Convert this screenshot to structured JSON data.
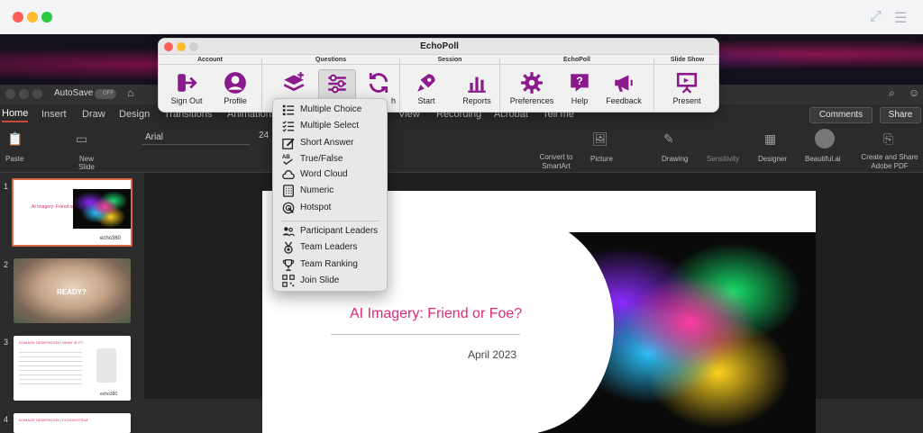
{
  "echopoll": {
    "title": "EchoPoll",
    "groups": {
      "account": "Account",
      "questions": "Questions",
      "session": "Session",
      "echopoll": "EchoPoll",
      "slideshow": "Slide Show"
    },
    "buttons": {
      "sign_out": "Sign Out",
      "profile": "Profile",
      "refresh_tail": "h",
      "start": "Start",
      "reports": "Reports",
      "preferences": "Preferences",
      "help": "Help",
      "feedback": "Feedback",
      "present": "Present"
    },
    "accent_color": "#8b1a8c"
  },
  "question_menu": {
    "items": [
      {
        "label": "Multiple Choice",
        "icon": "list-bullets-icon"
      },
      {
        "label": "Multiple Select",
        "icon": "checklist-icon"
      },
      {
        "label": "Short Answer",
        "icon": "edit-box-icon"
      },
      {
        "label": "True/False",
        "icon": "ab-check-icon"
      },
      {
        "label": "Word Cloud",
        "icon": "cloud-icon"
      },
      {
        "label": "Numeric",
        "icon": "keypad-icon"
      },
      {
        "label": "Hotspot",
        "icon": "target-pointer-icon"
      }
    ],
    "leader_items": [
      {
        "label": "Participant Leaders",
        "icon": "people-icon"
      },
      {
        "label": "Team Leaders",
        "icon": "medal-icon"
      },
      {
        "label": "Team Ranking",
        "icon": "trophy-icon"
      },
      {
        "label": "Join Slide",
        "icon": "qr-code-icon"
      }
    ]
  },
  "ppt": {
    "autosave": "AutoSave",
    "autosave_state": "OFF",
    "tabs": [
      "Home",
      "Insert",
      "Draw",
      "Design",
      "Transitions",
      "Animations",
      "View",
      "Recording",
      "Acrobat",
      "Tell me"
    ],
    "comments": "Comments",
    "share": "Share",
    "font_name": "Arial",
    "font_size": "24",
    "ribbon": {
      "paste": "Paste",
      "new_slide": "New\nSlide",
      "convert_to_smartart": "Convert to\nSmartArt",
      "picture": "Picture",
      "drawing": "Drawing",
      "sensitivity": "Sensitivity",
      "designer": "Designer",
      "beautiful_ai": "Beautiful.ai",
      "create_share_pdf": "Create and Share\nAdobe PDF"
    },
    "thumbnails": [
      {
        "num": "1",
        "title": "AI Imagery: Friend or Foe?",
        "brand": "echo360"
      },
      {
        "num": "2",
        "caption": "READY?"
      },
      {
        "num": "3",
        "heading": "AI IMAGE GENERATION | WHAT IS IT?",
        "brand": "echo360"
      },
      {
        "num": "4",
        "heading": "AI IMAGE GENERATION | ECHOSYSTEM"
      }
    ],
    "slide": {
      "title": "AI Imagery: Friend or Foe?",
      "date": "April 2023",
      "title_color": "#e0287a"
    }
  }
}
